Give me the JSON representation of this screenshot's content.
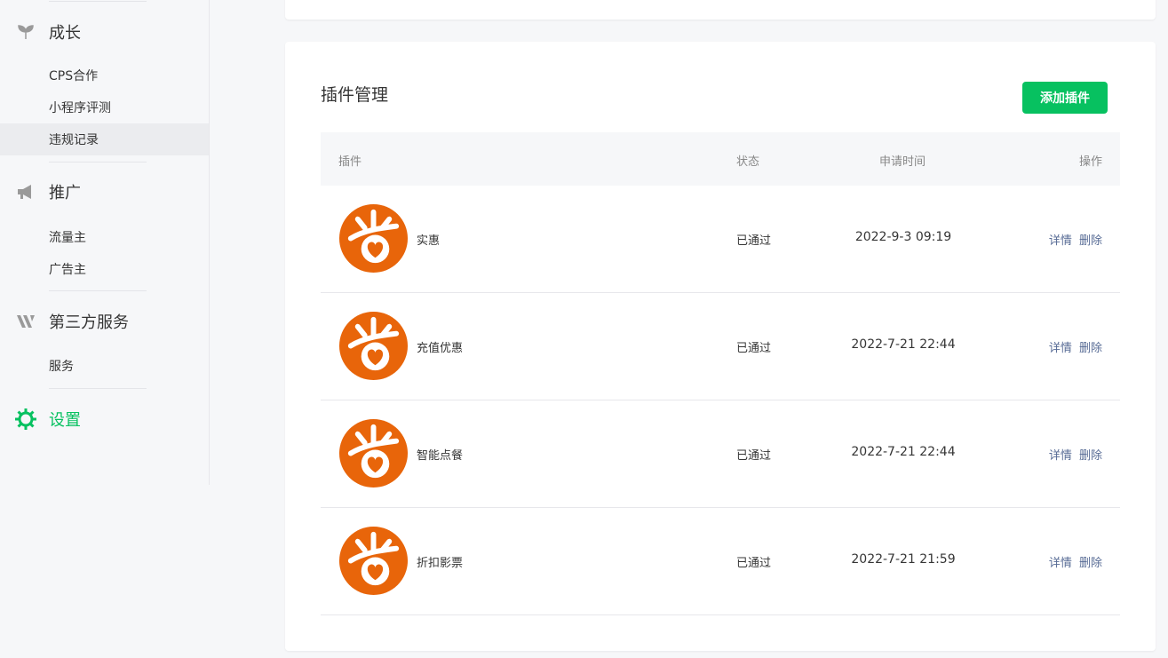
{
  "sidebar": {
    "groups": [
      {
        "title": "成长",
        "icon": "sprout-icon",
        "items": [
          "CPS合作",
          "小程序评测",
          "违规记录"
        ]
      },
      {
        "title": "推广",
        "icon": "megaphone-icon",
        "items": [
          "流量主",
          "广告主"
        ]
      },
      {
        "title": "第三方服务",
        "icon": "third-party-icon",
        "items": [
          "服务"
        ]
      },
      {
        "title": "设置",
        "icon": "gear-icon",
        "items": []
      }
    ],
    "selected_item": "违规记录",
    "active_group": "设置"
  },
  "panel": {
    "title": "插件管理",
    "add_button": "添加插件"
  },
  "table": {
    "headers": {
      "plugin": "插件",
      "status": "状态",
      "apply_time": "申请时间",
      "actions": "操作"
    },
    "rows": [
      {
        "name": "实惠",
        "status": "已通过",
        "time": "2022-9-3 09:19",
        "detail": "详情",
        "delete": "删除"
      },
      {
        "name": "充值优惠",
        "status": "已通过",
        "time": "2022-7-21 22:44",
        "detail": "详情",
        "delete": "删除"
      },
      {
        "name": "智能点餐",
        "status": "已通过",
        "time": "2022-7-21 22:44",
        "detail": "详情",
        "delete": "删除"
      },
      {
        "name": "折扣影票",
        "status": "已通过",
        "time": "2022-7-21 21:59",
        "detail": "详情",
        "delete": "删除"
      }
    ]
  },
  "colors": {
    "accent": "#07c160",
    "link": "#576b95",
    "logo": "#e8650a"
  }
}
